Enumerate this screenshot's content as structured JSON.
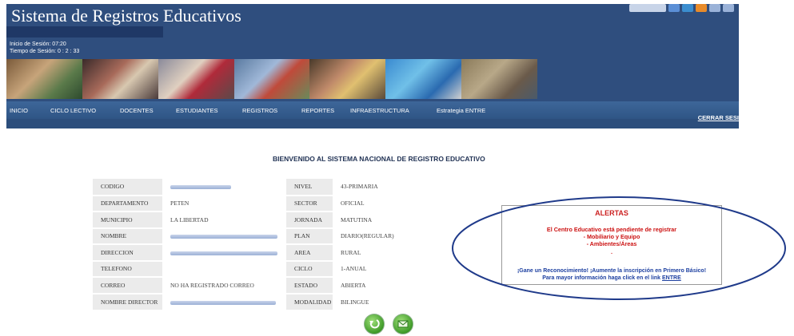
{
  "header": {
    "title": "Sistema de Registros Educativos",
    "session_start": "Inicio de Sesión: 07:20",
    "session_time": "Tiempo de Sesión: 0 : 2 : 33",
    "top_icon_colors": [
      "#c8d4e8",
      "#5b8fd6",
      "#3b8ed0",
      "#e88b2a",
      "#9ab2d8",
      "#9ab2d8"
    ]
  },
  "nav": {
    "items": [
      "INICIO",
      "CICLO LECTIVO",
      "DOCENTES",
      "ESTUDIANTES",
      "REGISTROS",
      "REPORTES",
      "INFRAESTRUCTURA",
      "Estrategia ENTRE"
    ],
    "logout": "CERRAR SESI"
  },
  "welcome": "BIENVENIDO AL SISTEMA NACIONAL DE REGISTRO EDUCATIVO",
  "school_info_left": [
    {
      "label": "CODIGO",
      "value": ""
    },
    {
      "label": "DEPARTAMENTO",
      "value": "PETEN"
    },
    {
      "label": "MUNICIPIO",
      "value": "LA LIBERTAD"
    },
    {
      "label": "NOMBRE",
      "value": ""
    },
    {
      "label": "DIRECCION",
      "value": ""
    },
    {
      "label": "TELEFONO",
      "value": ""
    },
    {
      "label": "CORREO",
      "value": "NO HA REGISTRADO CORREO"
    },
    {
      "label": "NOMBRE DIRECTOR",
      "value": ""
    }
  ],
  "school_info_right": [
    {
      "label": "NIVEL",
      "value": "43-PRIMARIA"
    },
    {
      "label": "SECTOR",
      "value": "OFICIAL"
    },
    {
      "label": "JORNADA",
      "value": "MATUTINA"
    },
    {
      "label": "PLAN",
      "value": "DIARIO(REGULAR)"
    },
    {
      "label": "AREA",
      "value": "RURAL"
    },
    {
      "label": "CICLO",
      "value": "1-ANUAL"
    },
    {
      "label": "ESTADO",
      "value": "ABIERTA"
    },
    {
      "label": "MODALIDAD",
      "value": "BILINGUE"
    }
  ],
  "alerts": {
    "title": "ALERTAS",
    "pending": "El Centro Educativo está pendiente de registrar",
    "item1": "- Mobiliario y Equipo",
    "item2": "- Ambientes/Áreas",
    "dot": ".",
    "promo": "¡Gane un Reconocimiento! ¡Aumente la inscripción en Primero Básico!",
    "info_prefix": "Para mayor información haga click en el link ",
    "link": "ENTRE"
  },
  "colors": {
    "header_bg": "#2f4e7e",
    "nav_bg": "#3d6699",
    "alert_red": "#cc1111",
    "alert_blue": "#1c3fa0",
    "highlight_ellipse": "#1f3a8a"
  },
  "icons": {
    "back": "back-arrow-icon",
    "mail": "mail-icon"
  }
}
